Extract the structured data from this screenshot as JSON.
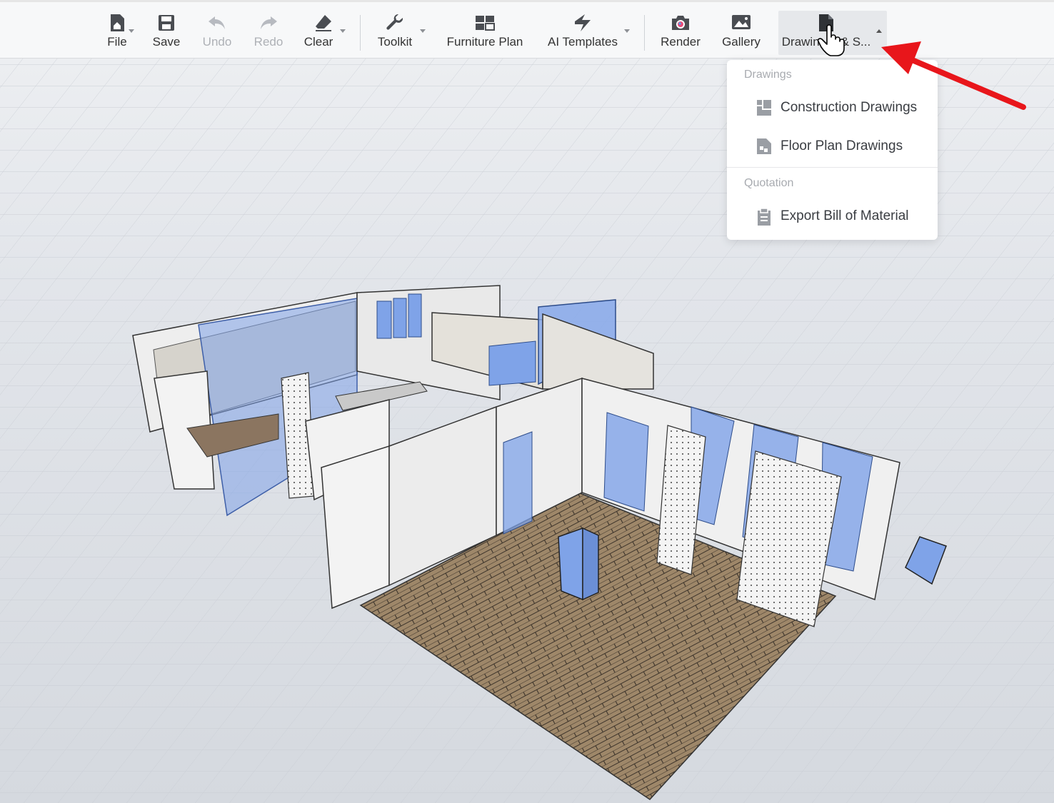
{
  "toolbar": {
    "file": {
      "label": "File",
      "icon": "home-file-icon",
      "has_caret": true
    },
    "save": {
      "label": "Save",
      "icon": "save-icon"
    },
    "undo": {
      "label": "Undo",
      "icon": "undo-icon",
      "disabled": true
    },
    "redo": {
      "label": "Redo",
      "icon": "redo-icon",
      "disabled": true
    },
    "clear": {
      "label": "Clear",
      "icon": "eraser-icon",
      "has_caret": true
    },
    "toolkit": {
      "label": "Toolkit",
      "icon": "wrench-icon",
      "has_caret": true
    },
    "furniture_plan": {
      "label": "Furniture Plan",
      "icon": "furniture-plan-icon"
    },
    "ai_templates": {
      "label": "AI Templates",
      "icon": "ai-templates-icon",
      "has_caret": true
    },
    "render": {
      "label": "Render",
      "icon": "camera-icon"
    },
    "gallery": {
      "label": "Gallery",
      "icon": "gallery-icon"
    },
    "drawings": {
      "label": "Drawin",
      "label_tail": "& S...",
      "icon": "document-icon",
      "active": true,
      "caret": "up"
    }
  },
  "dropdown": {
    "sections": [
      {
        "title": "Drawings",
        "items": [
          {
            "label": "Construction Drawings",
            "icon": "construction-drawing-icon"
          },
          {
            "label": "Floor Plan Drawings",
            "icon": "floor-plan-icon"
          }
        ]
      },
      {
        "title": "Quotation",
        "items": [
          {
            "label": "Export Bill of Material",
            "icon": "bill-of-material-icon"
          }
        ]
      }
    ]
  },
  "colors": {
    "toolbar_bg": "#f7f8f9",
    "text": "#333333",
    "disabled_text": "#aeb1b6",
    "section_title": "#a8abb0",
    "glass_blue": "#7fa3e8",
    "floor_wood": "#9c8468",
    "annotation_arrow": "#e8161b"
  }
}
